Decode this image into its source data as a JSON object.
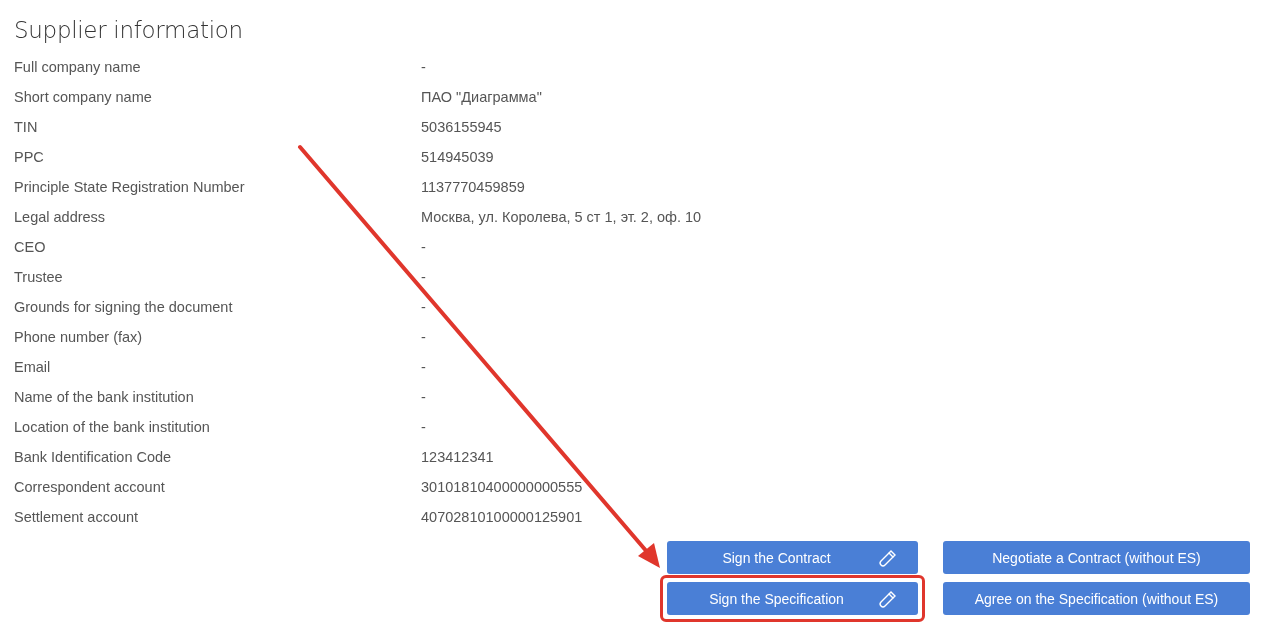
{
  "title": "Supplier information",
  "fields": [
    {
      "label": "Full company name",
      "value": "-"
    },
    {
      "label": "Short company name",
      "value": "ПАО \"Диаграмма\""
    },
    {
      "label": "TIN",
      "value": "5036155945"
    },
    {
      "label": "PPC",
      "value": "514945039"
    },
    {
      "label": "Principle State Registration Number",
      "value": "1137770459859"
    },
    {
      "label": "Legal address",
      "value": "Москва, ул. Королева, 5 ст 1, эт. 2, оф. 10"
    },
    {
      "label": "CEO",
      "value": "-"
    },
    {
      "label": "Trustee",
      "value": "-"
    },
    {
      "label": "Grounds for signing the document",
      "value": "-"
    },
    {
      "label": "Phone number (fax)",
      "value": "-"
    },
    {
      "label": "Email",
      "value": "-"
    },
    {
      "label": "Name of the bank institution",
      "value": "-"
    },
    {
      "label": "Location of the bank institution",
      "value": "-"
    },
    {
      "label": "Bank Identification Code",
      "value": "123412341"
    },
    {
      "label": "Correspondent account",
      "value": "30101810400000000555"
    },
    {
      "label": "Settlement account",
      "value": "40702810100000125901"
    }
  ],
  "buttons": [
    {
      "label": "Sign the Contract",
      "kind": "sign",
      "highlighted": false
    },
    {
      "label": "Negotiate a Contract (without ES)",
      "kind": "plain",
      "highlighted": false
    },
    {
      "label": "Sign the Specification",
      "kind": "sign",
      "highlighted": true
    },
    {
      "label": "Agree on the Specification (without ES)",
      "kind": "plain",
      "highlighted": false
    }
  ]
}
